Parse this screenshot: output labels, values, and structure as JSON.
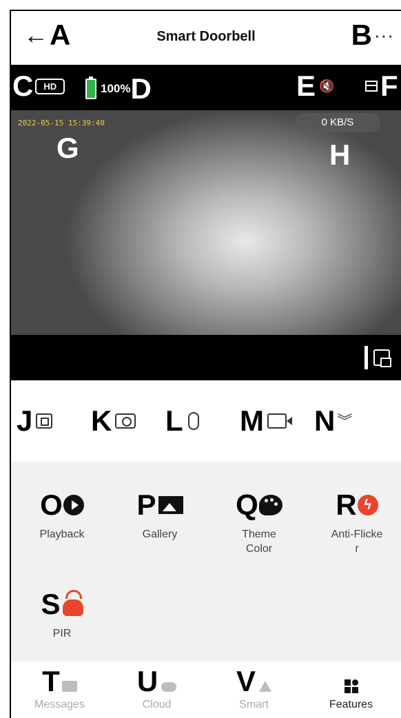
{
  "header": {
    "back_marker": "A",
    "back_arrow": "←",
    "title": "Smart Doorbell",
    "more_marker": "B",
    "more_dots": "···"
  },
  "video": {
    "marker_c": "C",
    "hd_label": "HD",
    "battery_percent": "100%",
    "marker_d": "D",
    "marker_e": "E",
    "mute_icon": "🔇",
    "marker_f": "F",
    "timestamp": "2022-05-15 15:39:40",
    "marker_g": "G",
    "speed": "0 KB/S",
    "marker_h": "H",
    "colors": {
      "battery": "#2fb34a",
      "timestamp": "#e8cf3a"
    }
  },
  "controls": [
    {
      "marker": "J",
      "icon": "screenshot-icon"
    },
    {
      "marker": "K",
      "icon": "camera-icon"
    },
    {
      "marker": "L",
      "icon": "microphone-icon"
    },
    {
      "marker": "M",
      "icon": "video-record-icon"
    },
    {
      "marker": "N",
      "icon": "chevron-down-double-icon",
      "glyph": "︾"
    }
  ],
  "features": [
    {
      "marker": "O",
      "label": "Playback",
      "icon": "play-icon"
    },
    {
      "marker": "P",
      "label": "Gallery",
      "icon": "gallery-icon"
    },
    {
      "marker": "Q",
      "label": "Theme\nColor",
      "icon": "palette-icon"
    },
    {
      "marker": "R",
      "label": "Anti-Flicke\nr",
      "icon": "flash-icon",
      "glyph": "ϟ"
    },
    {
      "marker": "S",
      "label": "PIR",
      "icon": "pir-sensor-icon"
    }
  ],
  "accent_color": "#e8452b",
  "nav": [
    {
      "marker": "T",
      "label": "Messages",
      "icon": "message-icon",
      "active": false
    },
    {
      "marker": "U",
      "label": "Cloud",
      "icon": "cloud-icon",
      "active": false
    },
    {
      "marker": "V",
      "label": "Smart",
      "icon": "smart-icon",
      "active": false
    },
    {
      "marker": "",
      "label": "Features",
      "icon": "features-icon",
      "active": true
    }
  ]
}
